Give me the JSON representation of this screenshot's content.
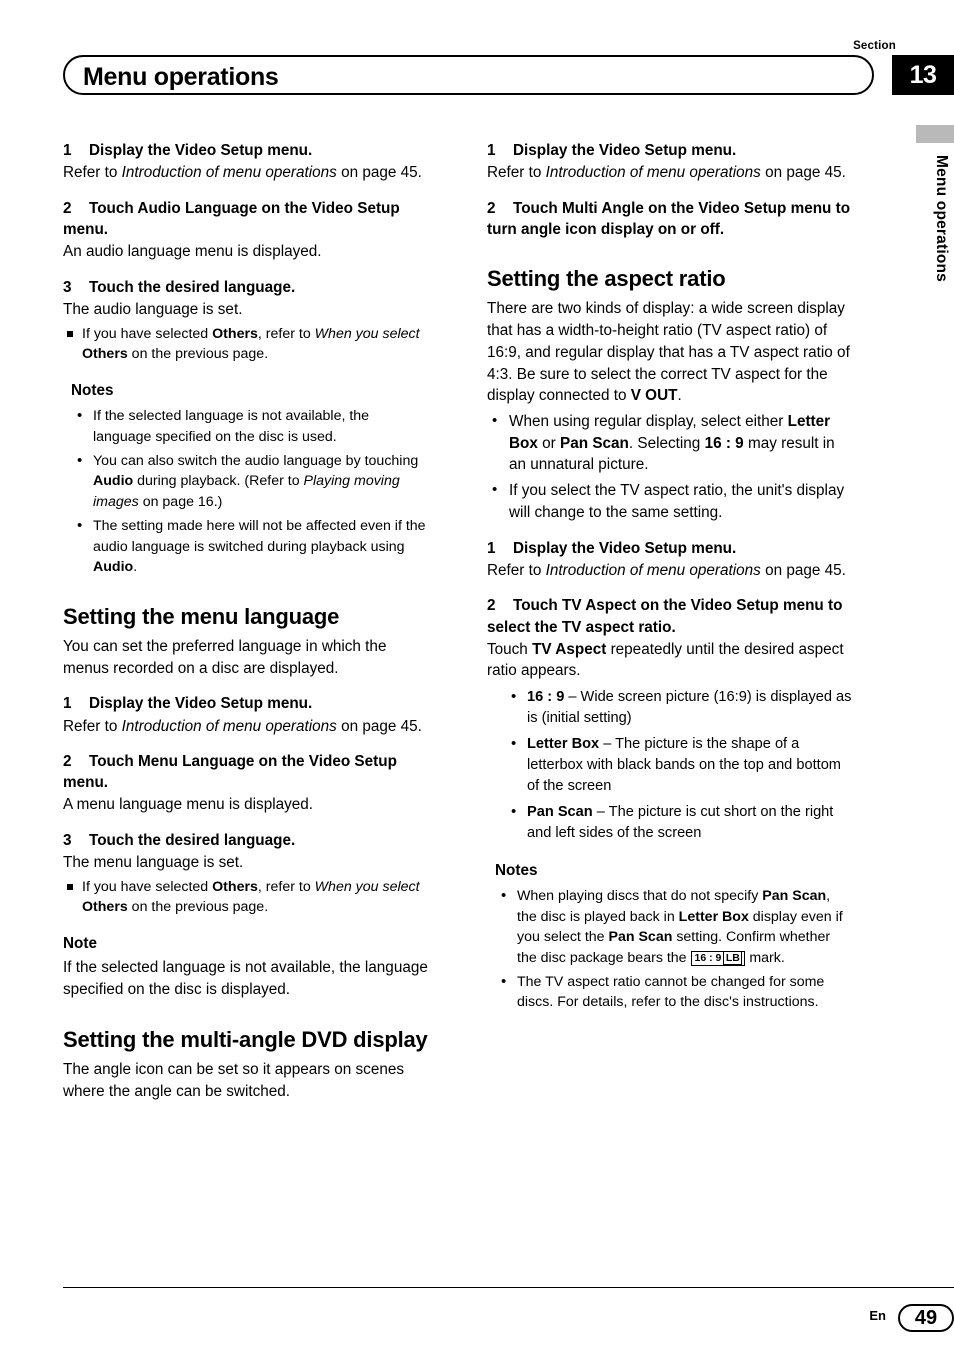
{
  "header": {
    "section_label": "Section",
    "section_number": "13",
    "title": "Menu operations",
    "side_running_head": "Menu operations"
  },
  "footer": {
    "language_code": "En",
    "page_number": "49"
  },
  "left_column": {
    "step1": {
      "num": "1",
      "text": "Display the Video Setup menu."
    },
    "step1_body_a": "Refer to ",
    "step1_body_b": "Introduction of menu operations",
    "step1_body_c": " on page 45.",
    "step2": {
      "num": "2",
      "text": "Touch Audio Language on the Video Setup menu."
    },
    "step2_body": "An audio language menu is displayed.",
    "step3": {
      "num": "3",
      "text": "Touch the desired language."
    },
    "step3_body": "The audio language is set.",
    "square_bullet_a": "If you have selected ",
    "square_bullet_b": "Others",
    "square_bullet_c": ", refer to ",
    "square_bullet_d": "When you select",
    "square_bullet_e": " Others",
    "square_bullet_f": " on the previous page.",
    "notes_heading": "Notes",
    "note1": "If the selected language is not available, the language specified on the disc is used.",
    "note2_a": "You can also switch the audio language by touching ",
    "note2_b": "Audio",
    "note2_c": " during playback. (Refer to ",
    "note2_d": "Playing moving images",
    "note2_e": " on page 16.)",
    "note3_a": "The setting made here will not be affected even if the audio language is switched during playback using ",
    "note3_b": "Audio",
    "note3_c": ".",
    "heading_menu_language": "Setting the menu language",
    "menu_language_intro": "You can set the preferred language in which the menus recorded on a disc are displayed.",
    "ml_step1": {
      "num": "1",
      "text": "Display the Video Setup menu."
    },
    "ml_step1_body_a": "Refer to ",
    "ml_step1_body_b": "Introduction of menu operations",
    "ml_step1_body_c": " on page 45.",
    "ml_step2": {
      "num": "2",
      "text": "Touch Menu Language on the Video Setup menu."
    },
    "ml_step2_body": "A menu language menu is displayed.",
    "ml_step3": {
      "num": "3",
      "text": "Touch the desired language."
    },
    "ml_step3_body": "The menu language is set.",
    "ml_square_a": "If you have selected ",
    "ml_square_b": "Others",
    "ml_square_c": ", refer to ",
    "ml_square_d": "When you select",
    "ml_square_e": " Others",
    "ml_square_f": " on the previous page.",
    "note_heading": "Note",
    "note_single": "If the selected language is not available, the language specified on the disc is displayed.",
    "heading_multi_angle": "Setting the multi-angle DVD display",
    "multi_angle_intro": "The angle icon can be set so it appears on scenes where the angle can be switched."
  },
  "right_column": {
    "step1": {
      "num": "1",
      "text": "Display the Video Setup menu."
    },
    "step1_body_a": "Refer to ",
    "step1_body_b": "Introduction of menu operations",
    "step1_body_c": " on page 45.",
    "step2": {
      "num": "2",
      "text": "Touch Multi Angle on the Video Setup menu to turn angle icon display on or off."
    },
    "heading_aspect_ratio": "Setting the aspect ratio",
    "aspect_intro_a": "There are two kinds of display: a wide screen display that has a width-to-height ratio (TV aspect ratio) of 16:9, and regular display that has a TV aspect ratio of 4:3. Be sure to select the correct TV aspect for the display connected to ",
    "aspect_intro_b": "V OUT",
    "aspect_intro_c": ".",
    "bullet1_a": "When using regular display, select either ",
    "bullet1_b": "Letter Box",
    "bullet1_c": " or ",
    "bullet1_d": "Pan Scan",
    "bullet1_e": ". Selecting ",
    "bullet1_f": "16 : 9",
    "bullet1_g": " may result in an unnatural picture.",
    "bullet2": "If you select the TV aspect ratio, the unit's display will change to the same setting.",
    "ar_step1": {
      "num": "1",
      "text": "Display the Video Setup menu."
    },
    "ar_step1_body_a": "Refer to ",
    "ar_step1_body_b": "Introduction of menu operations",
    "ar_step1_body_c": " on page 45.",
    "ar_step2": {
      "num": "2",
      "text": "Touch TV Aspect on the Video Setup menu to select the TV aspect ratio."
    },
    "ar_step2_body_a": "Touch ",
    "ar_step2_body_b": "TV Aspect",
    "ar_step2_body_c": " repeatedly until the desired aspect ratio appears.",
    "opt1_label": "16 : 9",
    "opt1_text": " – Wide screen picture (16:9) is displayed as is (initial setting)",
    "opt2_label": "Letter Box",
    "opt2_text": " – The picture is the shape of a letterbox with black bands on the top and bottom of the screen",
    "opt3_label": "Pan Scan",
    "opt3_text": " – The picture is cut short on the right and left sides of the screen",
    "notes_heading": "Notes",
    "note1_a": "When playing discs that do not specify ",
    "note1_b": "Pan Scan",
    "note1_c": ", the disc is played back in ",
    "note1_d": "Letter Box",
    "note1_e": " display even if you select the ",
    "note1_f": "Pan Scan",
    "note1_g": " setting. Confirm whether the disc package bears the ",
    "note1_mark_main": "16 : 9",
    "note1_mark_sub": "LB",
    "note1_h": " mark.",
    "note2": "The TV aspect ratio cannot be changed for some discs. For details, refer to the disc's instructions."
  }
}
